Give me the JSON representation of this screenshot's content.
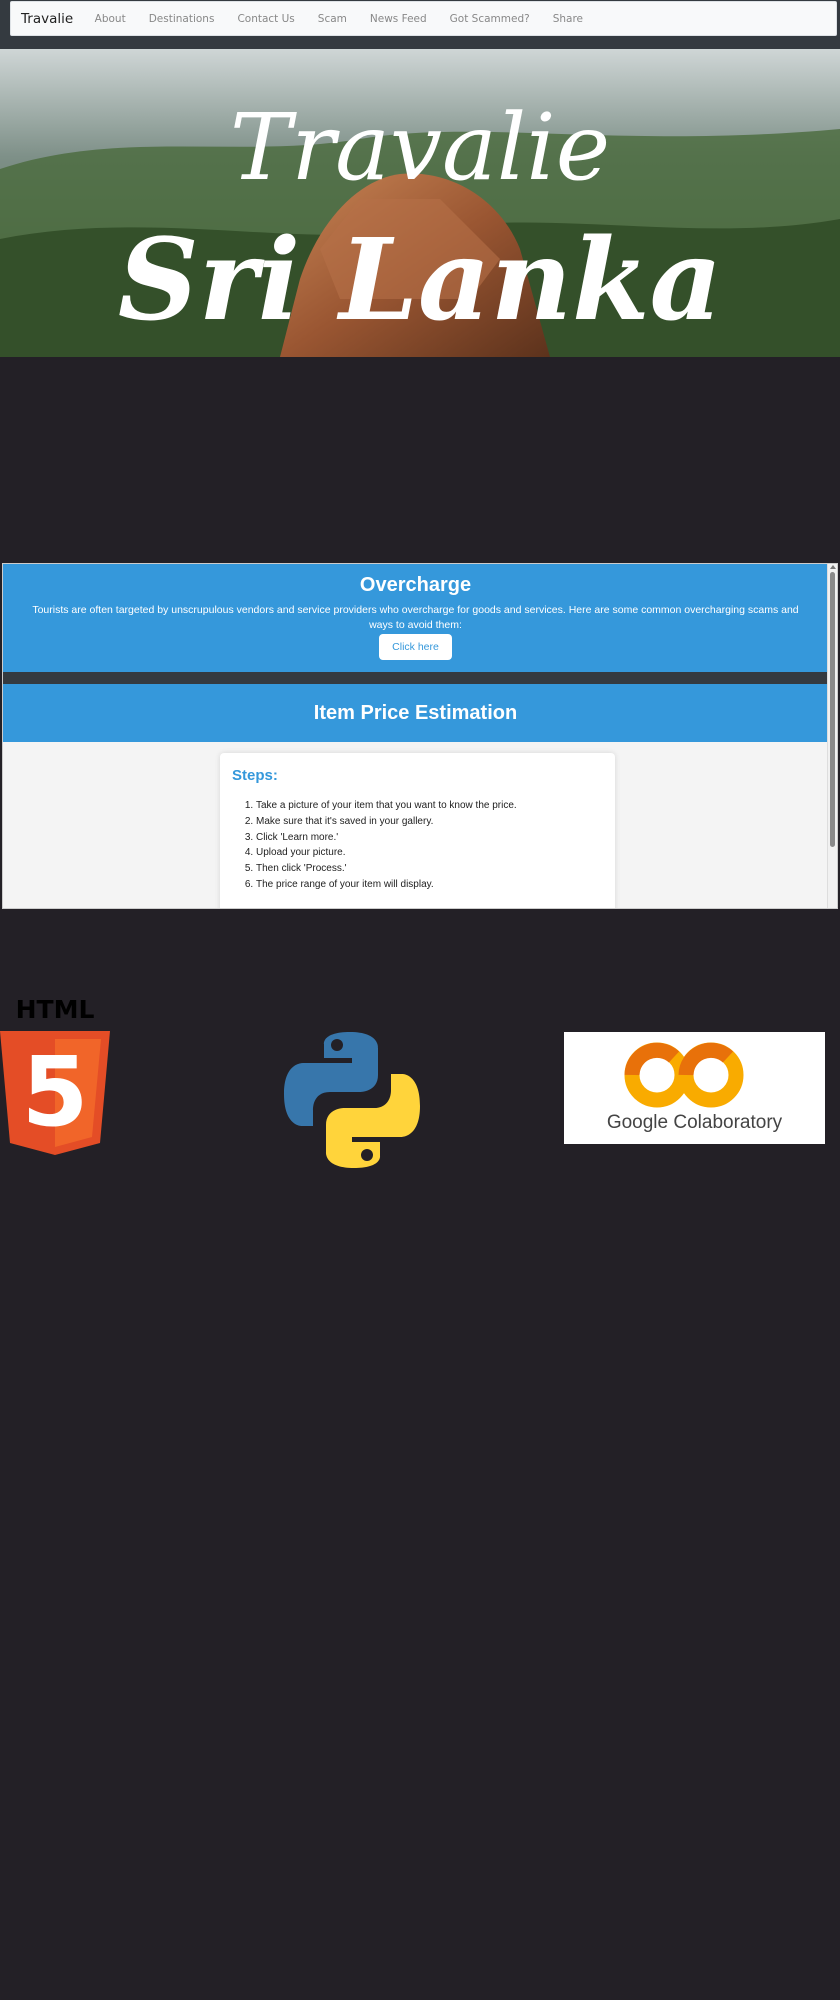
{
  "navbar": {
    "brand": "Travalie",
    "links": [
      "About",
      "Destinations",
      "Contact Us",
      "Scam",
      "News Feed",
      "Got Scammed?",
      "Share"
    ]
  },
  "hero": {
    "script_title": "Travalie",
    "script_subtitle": "Sri Lanka"
  },
  "overcharge": {
    "title": "Overcharge",
    "description": "Tourists are often targeted by unscrupulous vendors and service providers who overcharge for goods and services. Here are some common overcharging scams and ways to avoid them:",
    "button_label": "Click here"
  },
  "estimation": {
    "title": "Item Price Estimation",
    "steps_heading": "Steps:",
    "steps": [
      "Take a picture of your item that you want to know the price.",
      "Make sure that it's saved in your gallery.",
      "Click 'Learn more.'",
      "Upload your picture.",
      "Then click 'Process.'",
      "The price range of your item will display."
    ]
  },
  "logos": {
    "html_label": "HTML",
    "html_number": "5",
    "colab_label": "Google Colaboratory",
    "colab_mark": "CO"
  },
  "colors": {
    "accent_blue": "#3598db",
    "page_bg": "#232026",
    "html_orange": "#e44d26",
    "python_blue": "#3776ab",
    "python_yellow": "#ffd43b",
    "colab_yellow": "#f9ab00"
  }
}
